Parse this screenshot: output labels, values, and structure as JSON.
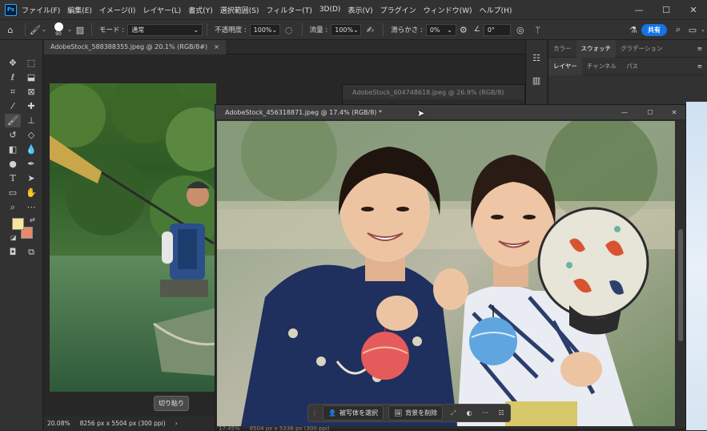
{
  "app": {
    "logo": "Ps"
  },
  "menu": [
    "ファイル(F)",
    "編集(E)",
    "イメージ(I)",
    "レイヤー(L)",
    "書式(Y)",
    "選択範囲(S)",
    "フィルター(T)",
    "3D(D)",
    "表示(V)",
    "プラグイン",
    "ウィンドウ(W)",
    "ヘルプ(H)"
  ],
  "options": {
    "brush_size": "90",
    "mode_label": "モード :",
    "mode_value": "通常",
    "opacity_label": "不透明度 :",
    "opacity_value": "100%",
    "flow_label": "流量 :",
    "flow_value": "100%",
    "smoothing_label": "滑らかさ :",
    "smoothing_value": "0%",
    "angle_value": "0°",
    "share_label": "共有"
  },
  "tabs": [
    {
      "title": "AdobeStock_588388355.jpeg @ 20.1% (RGB/8#)",
      "close": "×"
    }
  ],
  "windows": {
    "back": {
      "title": "AdobeStock_604748618.jpeg @ 26.9% (RGB/8)"
    },
    "front": {
      "title": "AdobeStock_456318871.jpeg @ 17.4% (RGB/8) *"
    }
  },
  "canvas": {
    "paste_label": "切り貼り"
  },
  "status": {
    "zoom": "20.08%",
    "dimensions": "8256 px x 5504 px (300 ppi)",
    "arrow": "›"
  },
  "front_status": {
    "zoom": "17.45%",
    "dimensions": "8504 px x 5336 px (300 ppi)"
  },
  "contextbar": {
    "select_subject": "被写体を選択",
    "remove_bg": "背景を削除",
    "more": "···"
  },
  "right_panel": {
    "tabs_top": [
      "カラー",
      "スウォッチ",
      "グラデーション"
    ],
    "tabs_bottom": [
      "レイヤー",
      "チャンネル",
      "パス"
    ]
  },
  "colors": {
    "foreground": "#f9e59b",
    "background": "#e68a6e",
    "accent": "#1473e6"
  }
}
